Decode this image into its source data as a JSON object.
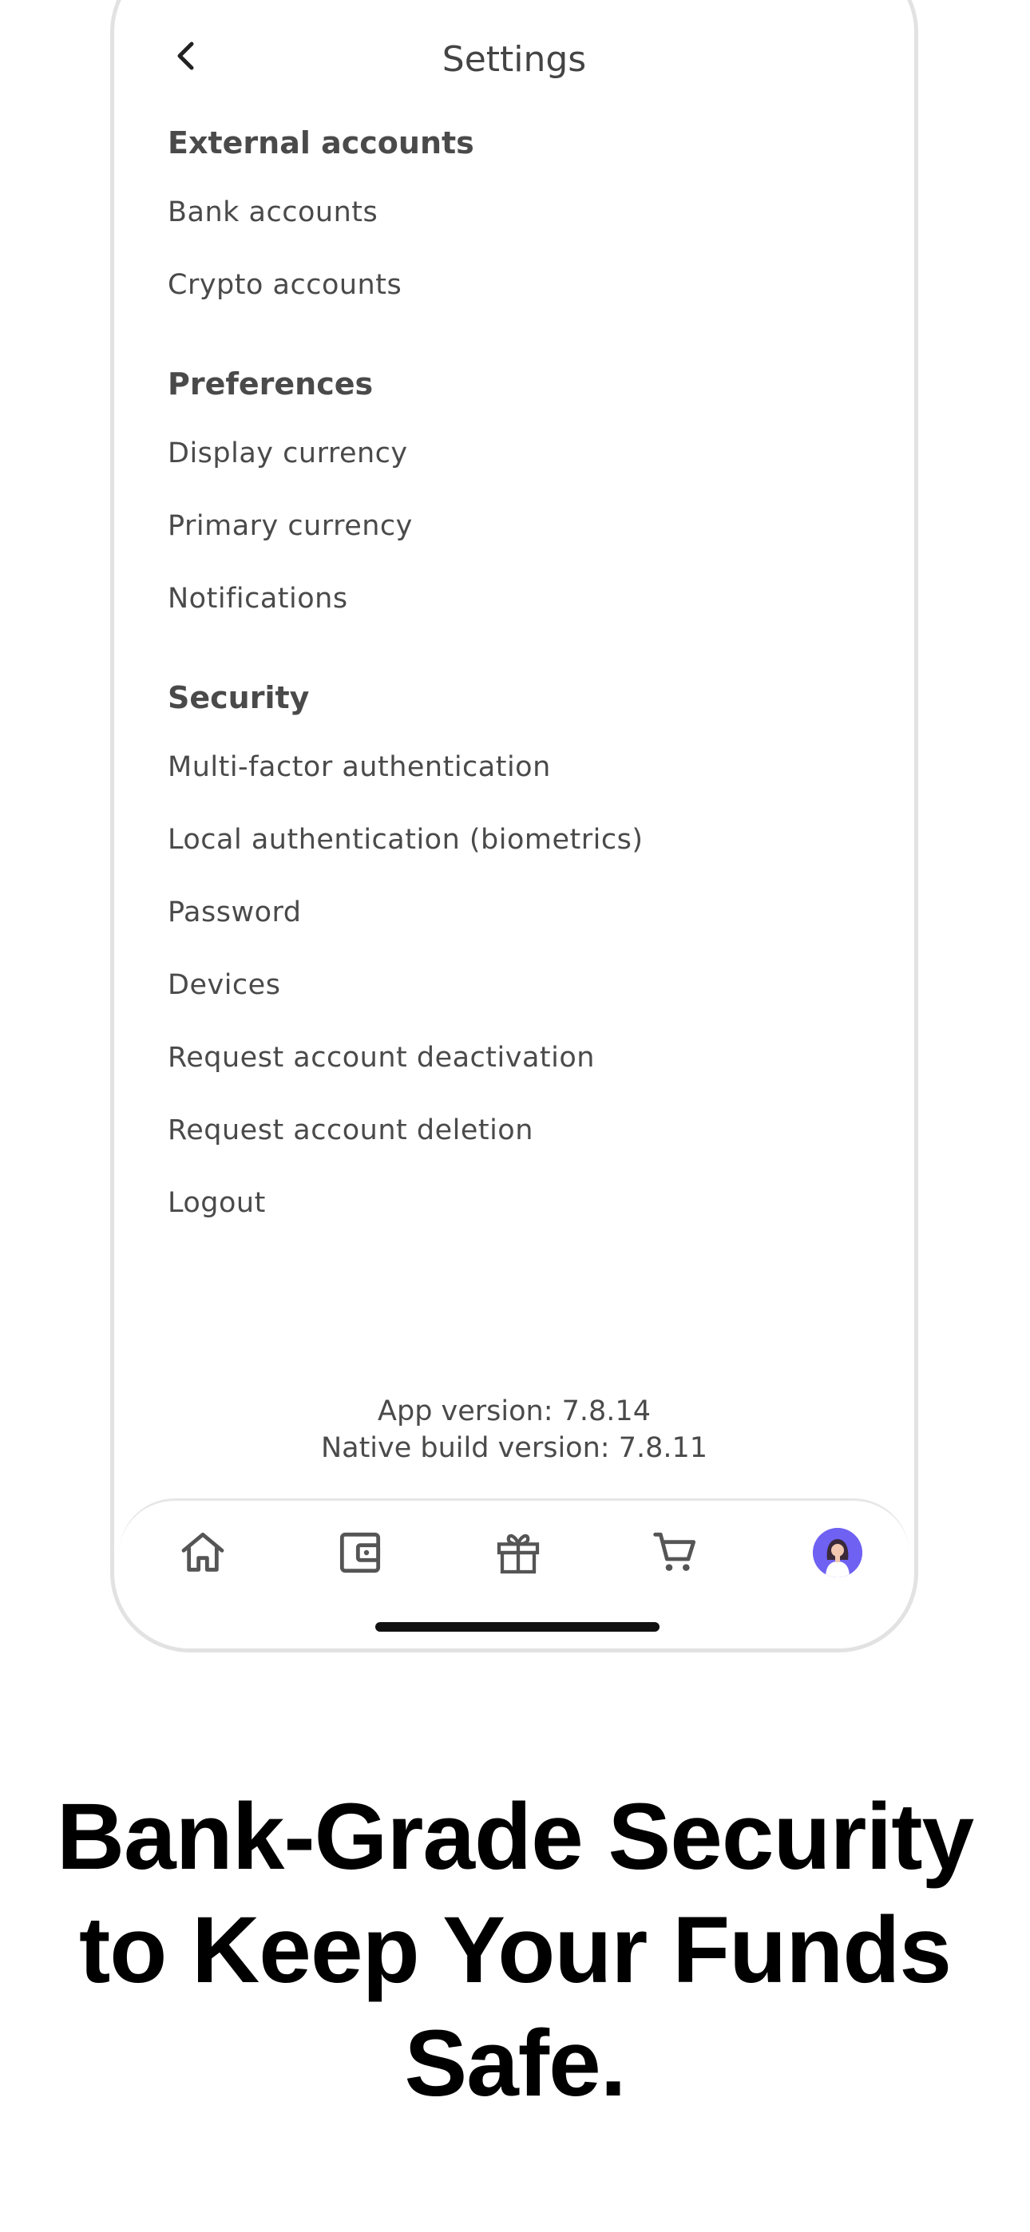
{
  "header": {
    "title": "Settings"
  },
  "sections": [
    {
      "title": "External accounts",
      "items": [
        "Bank accounts",
        "Crypto accounts"
      ]
    },
    {
      "title": "Preferences",
      "items": [
        "Display currency",
        "Primary currency",
        "Notifications"
      ]
    },
    {
      "title": "Security",
      "items": [
        "Multi-factor authentication",
        "Local authentication (biometrics)",
        "Password",
        "Devices",
        "Request account deactivation",
        "Request account deletion",
        "Logout"
      ]
    }
  ],
  "version": {
    "app": "App version: 7.8.14",
    "native": "Native build version: 7.8.11"
  },
  "nav": {
    "icons": [
      "home-icon",
      "wallet-icon",
      "gift-icon",
      "cart-icon",
      "profile-avatar"
    ],
    "avatar_color": "#6f61f2"
  },
  "tagline": {
    "line1": "Bank-Grade Security",
    "line2": "to Keep Your Funds",
    "line3": "Safe."
  }
}
